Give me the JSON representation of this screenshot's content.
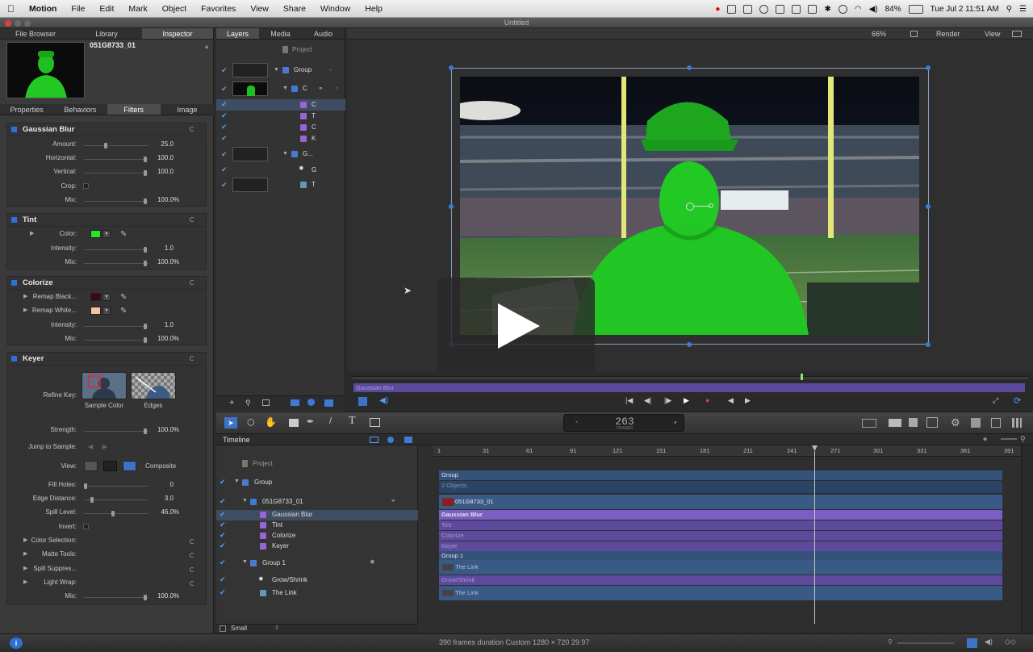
{
  "menubar": {
    "app": "Motion",
    "items": [
      "File",
      "Edit",
      "Mark",
      "Object",
      "Favorites",
      "View",
      "Share",
      "Window",
      "Help"
    ],
    "battery": "84%",
    "clock": "Tue Jul 2  11:51 AM"
  },
  "window": {
    "title": "Untitled"
  },
  "inspector": {
    "top_tabs": [
      "File Browser",
      "Library",
      "Inspector"
    ],
    "clip_name": "051G8733_01",
    "sub_tabs": [
      "Properties",
      "Behaviors",
      "Filters",
      "Image"
    ],
    "gaussian": {
      "title": "Gaussian Blur",
      "amount_label": "Amount:",
      "amount": "25.0",
      "horizontal_label": "Horizontal:",
      "horizontal": "100.0",
      "vertical_label": "Vertical:",
      "vertical": "100.0",
      "crop_label": "Crop:",
      "mix_label": "Mix:",
      "mix": "100.0",
      "unit": "%"
    },
    "tint": {
      "title": "Tint",
      "color_label": "Color:",
      "color": "#27e22a",
      "intensity_label": "Intensity:",
      "intensity": "1.0",
      "mix_label": "Mix:",
      "mix": "100.0",
      "unit": "%"
    },
    "colorize": {
      "title": "Colorize",
      "black_label": "Remap Black...",
      "black_color": "#3a0a10",
      "white_label": "Remap White...",
      "white_color": "#f6c3a0",
      "intensity_label": "Intensity:",
      "intensity": "1.0",
      "mix_label": "Mix:",
      "mix": "100.0",
      "unit": "%"
    },
    "keyer": {
      "title": "Keyer",
      "refine_label": "Refine Key:",
      "sample_color": "Sample Color",
      "edges": "Edges",
      "strength_label": "Strength:",
      "strength": "100.0",
      "jump_label": "Jump to Sample:",
      "view_label": "View:",
      "view_value": "Composite",
      "fill_holes_label": "Fill Holes:",
      "fill_holes": "0",
      "edge_distance_label": "Edge Distance:",
      "edge_distance": "3.0",
      "spill_level_label": "Spill Level:",
      "spill_level": "46.0",
      "invert_label": "Invert:",
      "color_selection": "Color Selection:",
      "matte_tools": "Matte Tools:",
      "spill_suppress": "Spill Suppres...",
      "light_wrap": "Light Wrap:",
      "mix_label": "Mix:",
      "mix": "100.0",
      "unit": "%"
    }
  },
  "layers": {
    "tabs": [
      "Layers",
      "Media",
      "Audio"
    ],
    "project": "Project",
    "rows": [
      "Group",
      "C",
      "C",
      "T",
      "C",
      "K",
      "G...",
      "G",
      "T"
    ]
  },
  "canvas": {
    "zoom": "66%",
    "render": "Render",
    "view": "View",
    "mini_track": "Gaussian Blur"
  },
  "toolbar": {
    "timecode": "263",
    "frames_label": "FRAMES"
  },
  "timeline": {
    "title": "Timeline",
    "project": "Project",
    "rows": [
      "Group",
      "051G8733_01",
      "Gaussian Blur",
      "Tint",
      "Colorize",
      "Keyer",
      "Group 1",
      "Grow/Shrink",
      "The Link"
    ],
    "ruler": [
      "1",
      "31",
      "61",
      "91",
      "121",
      "151",
      "181",
      "211",
      "241",
      "271",
      "301",
      "331",
      "361",
      "391"
    ],
    "tracks": [
      "Group",
      "2 Objects",
      "051G8733_01",
      "Gaussian Blur",
      "Tint",
      "Colorize",
      "Keyer",
      "Group 1",
      "The Link",
      "Grow/Shrink",
      "The Link"
    ],
    "size": "Small"
  },
  "status": {
    "text": "390 frames duration Custom 1280 × 720 29.97"
  },
  "colors": {
    "accent": "#3d7bd6",
    "filter_track": "#6b4ea8",
    "group_track": "#34527a"
  }
}
